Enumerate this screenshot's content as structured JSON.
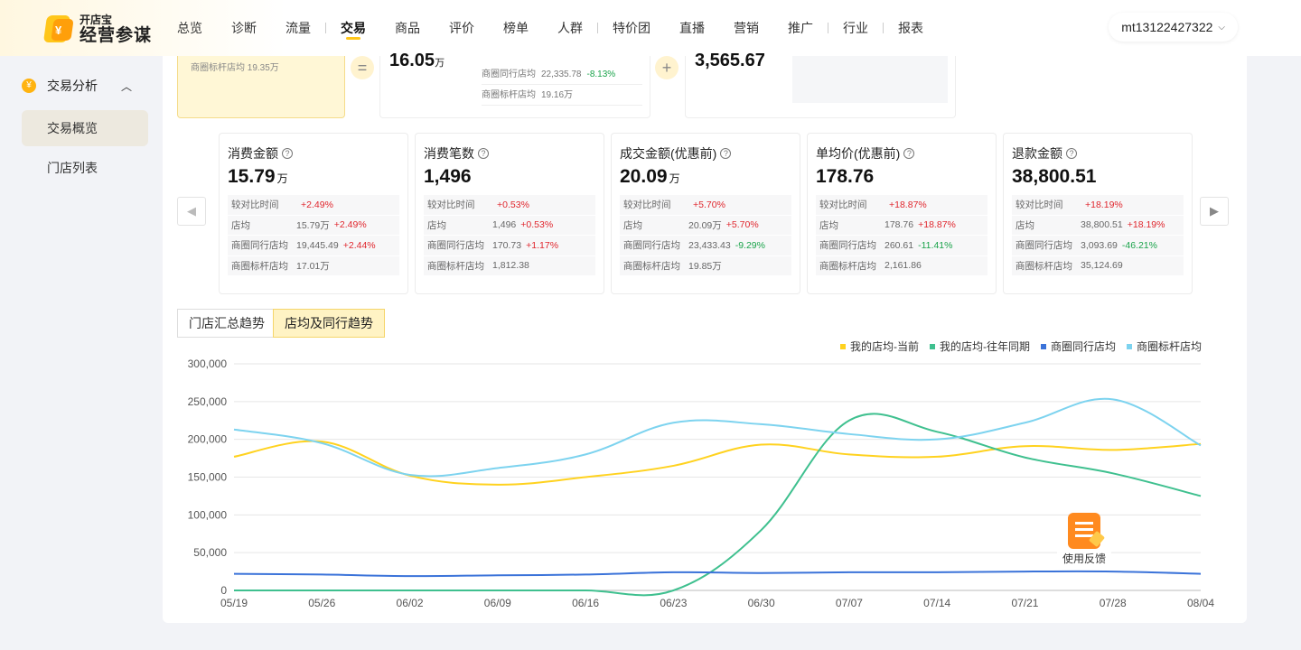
{
  "logo": {
    "line1": "开店宝",
    "line2": "经营参谋",
    "mark": "¥"
  },
  "nav": {
    "items": [
      "总览",
      "诊断",
      "流量",
      "交易",
      "商品",
      "评价",
      "榜单",
      "人群",
      "特价团",
      "直播",
      "营销",
      "推广",
      "行业",
      "报表"
    ],
    "active": "交易"
  },
  "account": {
    "name": "mt13122427322",
    "chevron": "⌵"
  },
  "sidebar": {
    "group_icon": "¥",
    "group_label": "交易分析",
    "group_chevron": "︿",
    "items": [
      {
        "label": "交易概览",
        "active": true
      },
      {
        "label": "门店列表",
        "active": false
      }
    ]
  },
  "top_partial": {
    "yellow_text": "商圈标杆店均  19.35万",
    "op1": "=",
    "op2": "+",
    "card1_value": "16.05",
    "card1_unit": "万",
    "card1_rows": [
      {
        "label": "商圈同行店均",
        "value": "22,335.78",
        "change": "-8.13%"
      },
      {
        "label": "商圈标杆店均",
        "value": "19.16万",
        "change": ""
      }
    ],
    "card2_value": "3,565.67"
  },
  "arrows": {
    "left": "◀",
    "right": "▶"
  },
  "metrics": [
    {
      "title": "消费金额",
      "value": "15.79",
      "unit": "万",
      "rows": [
        {
          "label": "较对比时间",
          "value": "",
          "change": "+2.49%"
        },
        {
          "label": "店均",
          "value": "15.79万",
          "change": "+2.49%"
        },
        {
          "label": "商圈同行店均",
          "value": "19,445.49",
          "change": "+2.44%"
        },
        {
          "label": "商圈标杆店均",
          "value": "17.01万",
          "change": ""
        }
      ]
    },
    {
      "title": "消费笔数",
      "value": "1,496",
      "unit": "",
      "rows": [
        {
          "label": "较对比时间",
          "value": "",
          "change": "+0.53%"
        },
        {
          "label": "店均",
          "value": "1,496",
          "change": "+0.53%"
        },
        {
          "label": "商圈同行店均",
          "value": "170.73",
          "change": "+1.17%"
        },
        {
          "label": "商圈标杆店均",
          "value": "1,812.38",
          "change": ""
        }
      ]
    },
    {
      "title": "成交金额(优惠前)",
      "value": "20.09",
      "unit": "万",
      "rows": [
        {
          "label": "较对比时间",
          "value": "",
          "change": "+5.70%"
        },
        {
          "label": "店均",
          "value": "20.09万",
          "change": "+5.70%"
        },
        {
          "label": "商圈同行店均",
          "value": "23,433.43",
          "change": "-9.29%"
        },
        {
          "label": "商圈标杆店均",
          "value": "19.85万",
          "change": ""
        }
      ]
    },
    {
      "title": "单均价(优惠前)",
      "value": "178.76",
      "unit": "",
      "rows": [
        {
          "label": "较对比时间",
          "value": "",
          "change": "+18.87%"
        },
        {
          "label": "店均",
          "value": "178.76",
          "change": "+18.87%"
        },
        {
          "label": "商圈同行店均",
          "value": "260.61",
          "change": "-11.41%"
        },
        {
          "label": "商圈标杆店均",
          "value": "2,161.86",
          "change": ""
        }
      ]
    },
    {
      "title": "退款金额",
      "value": "38,800.51",
      "unit": "",
      "rows": [
        {
          "label": "较对比时间",
          "value": "",
          "change": "+18.19%"
        },
        {
          "label": "店均",
          "value": "38,800.51",
          "change": "+18.19%"
        },
        {
          "label": "商圈同行店均",
          "value": "3,093.69",
          "change": "-46.21%"
        },
        {
          "label": "商圈标杆店均",
          "value": "35,124.69",
          "change": ""
        }
      ]
    }
  ],
  "tabs": [
    {
      "label": "门店汇总趋势",
      "active": false
    },
    {
      "label": "店均及同行趋势",
      "active": true
    }
  ],
  "feedback": {
    "label": "使用反馈"
  },
  "colors": {
    "accent": "#ffc61a",
    "up": "#e0262d",
    "down": "#1aa34a"
  },
  "chart_data": {
    "type": "line",
    "x": [
      "05/19",
      "05/26",
      "06/02",
      "06/09",
      "06/16",
      "06/23",
      "06/30",
      "07/07",
      "07/14",
      "07/21",
      "07/28",
      "08/04"
    ],
    "ylim": [
      0,
      300000
    ],
    "yticks": [
      "0",
      "50,000",
      "100,000",
      "150,000",
      "200,000",
      "250,000",
      "300,000"
    ],
    "grid": true,
    "legend_position": "top-right",
    "series": [
      {
        "name": "我的店均-当前",
        "color": "#ffd21f",
        "values": [
          177000,
          197000,
          152000,
          140000,
          150000,
          165000,
          193000,
          180000,
          177000,
          191000,
          186000,
          194000
        ]
      },
      {
        "name": "我的店均-往年同期",
        "color": "#3fc08f",
        "values": [
          0,
          0,
          0,
          0,
          0,
          0,
          80000,
          225000,
          210000,
          176000,
          155000,
          125000
        ]
      },
      {
        "name": "商圈同行店均",
        "color": "#3b73d9",
        "values": [
          22000,
          21000,
          19000,
          20000,
          21000,
          24000,
          23000,
          24000,
          24000,
          25000,
          25000,
          22000
        ]
      },
      {
        "name": "商圈标杆店均",
        "color": "#7dd3ef",
        "values": [
          213000,
          195000,
          153000,
          162000,
          180000,
          222000,
          220000,
          207000,
          200000,
          222000,
          253000,
          192000
        ]
      }
    ]
  }
}
